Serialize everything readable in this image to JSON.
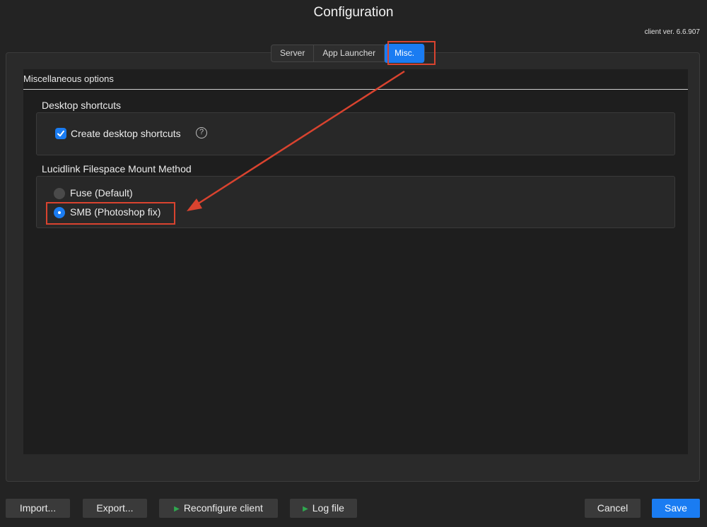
{
  "window": {
    "title": "Configuration",
    "version": "client ver. 6.6.907"
  },
  "tabs": [
    {
      "label": "Server"
    },
    {
      "label": "App Launcher"
    },
    {
      "label": "Misc.",
      "active": true
    }
  ],
  "misc": {
    "section_title": "Miscellaneous options",
    "desktop": {
      "heading": "Desktop shortcuts",
      "checkbox_label": "Create desktop shortcuts",
      "checked": true,
      "help_glyph": "?"
    },
    "mount": {
      "heading": "Lucidlink Filespace Mount Method",
      "options": [
        {
          "label": "Fuse (Default)",
          "selected": false
        },
        {
          "label": "SMB (Photoshop fix)",
          "selected": true
        }
      ]
    }
  },
  "footer": {
    "import_label": "Import...",
    "export_label": "Export...",
    "reconfigure_label": "Reconfigure client",
    "logfile_label": "Log file",
    "play_glyph": "▶",
    "cancel_label": "Cancel",
    "save_label": "Save"
  },
  "colors": {
    "accent": "#1a7cf2",
    "annotation": "#d9432f",
    "play": "#2fa84f"
  }
}
